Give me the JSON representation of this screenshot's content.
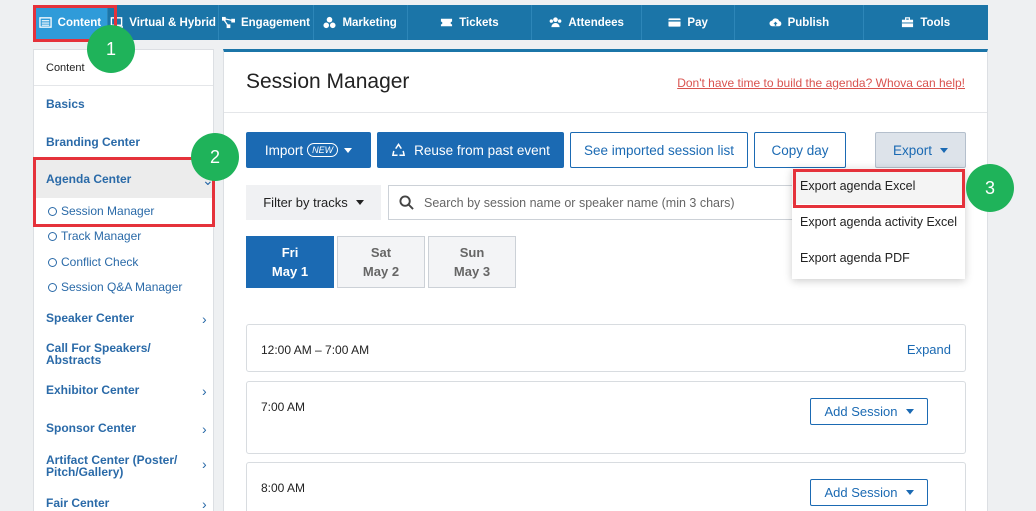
{
  "nav": {
    "tabs": [
      {
        "label": "Content",
        "icon": "list-icon"
      },
      {
        "label": "Virtual & Hybrid",
        "icon": "monitor-icon"
      },
      {
        "label": "Engagement",
        "icon": "network-icon"
      },
      {
        "label": "Marketing",
        "icon": "marketing-icon"
      },
      {
        "label": "Tickets",
        "icon": "ticket-icon"
      },
      {
        "label": "Attendees",
        "icon": "users-icon"
      },
      {
        "label": "Pay",
        "icon": "card-icon"
      },
      {
        "label": "Publish",
        "icon": "cloud-upload-icon"
      },
      {
        "label": "Tools",
        "icon": "toolbox-icon"
      }
    ]
  },
  "sidebar": {
    "header": "Content",
    "basics": "Basics",
    "branding": "Branding Center",
    "agenda": "Agenda Center",
    "agenda_subitems": [
      "Session Manager",
      "Track Manager",
      "Conflict Check",
      "Session Q&A Manager"
    ],
    "speaker": "Speaker Center",
    "cfs_line1": "Call For Speakers/",
    "cfs_line2": "Abstracts",
    "exhibitor": "Exhibitor Center",
    "sponsor": "Sponsor Center",
    "artifact_line1": "Artifact Center (Poster/",
    "artifact_line2": "Pitch/Gallery)",
    "fair": "Fair Center"
  },
  "main": {
    "title": "Session Manager",
    "promo": "Don't have time to build the agenda? Whova can help!",
    "import_label": "Import",
    "new_badge": "NEW",
    "reuse_label": "Reuse from past event",
    "see_imported_label": "See imported session list",
    "copy_day_label": "Copy day",
    "export_label": "Export",
    "filter_label": "Filter by tracks",
    "search_placeholder": "Search by session name or speaker name (min 3 chars)",
    "days": [
      {
        "dow": "Fri",
        "date": "May 1"
      },
      {
        "dow": "Sat",
        "date": "May 2"
      },
      {
        "dow": "Sun",
        "date": "May 3"
      }
    ],
    "slot1_time": "12:00 AM – 7:00 AM",
    "expand_label": "Expand",
    "slot2_time": "7:00 AM",
    "slot3_time": "8:00 AM",
    "add_session_label": "Add Session"
  },
  "export_menu": {
    "options": [
      "Export agenda Excel",
      "Export agenda activity Excel",
      "Export agenda PDF"
    ]
  },
  "annotations": {
    "step1": "1",
    "step2": "2",
    "step3": "3",
    "highlight_color": "#e5323b",
    "badge_color": "#1fb35a"
  }
}
